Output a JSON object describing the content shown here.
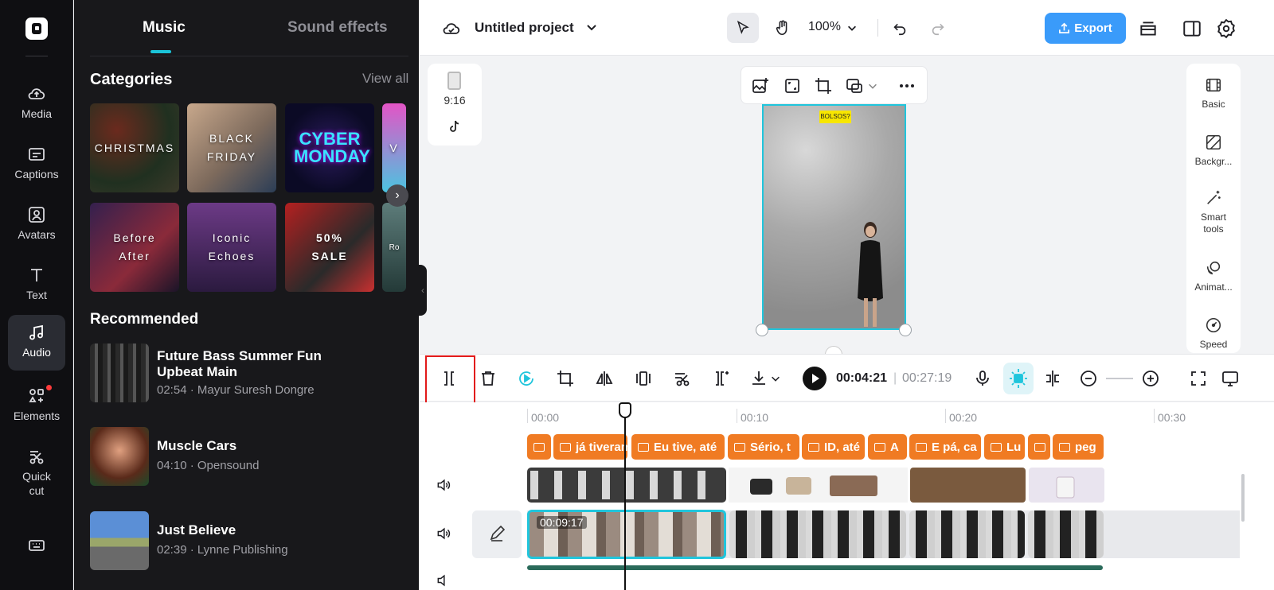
{
  "app": {
    "project_title": "Untitled project",
    "zoom": "100%",
    "export_label": "Export"
  },
  "rail": {
    "items": [
      {
        "label": "Media",
        "icon": "cloud-upload-icon"
      },
      {
        "label": "Captions",
        "icon": "captions-icon"
      },
      {
        "label": "Avatars",
        "icon": "avatar-icon"
      },
      {
        "label": "Text",
        "icon": "text-icon"
      },
      {
        "label": "Audio",
        "icon": "music-note-icon",
        "active": true
      },
      {
        "label": "Elements",
        "icon": "elements-icon",
        "badge": true
      },
      {
        "label": "Quick\ncut",
        "icon": "quick-cut-icon"
      },
      {
        "label": "",
        "icon": "keyboard-icon"
      }
    ]
  },
  "panel": {
    "tabs": [
      "Music",
      "Sound effects"
    ],
    "active_tab": "Music",
    "categories_title": "Categories",
    "view_all": "View all",
    "categories": [
      "CHRISTMAS",
      "BLACK FRIDAY",
      "CYBER MONDAY",
      "V",
      "Before After",
      "Iconic Echoes",
      "50% SALE",
      "Ro"
    ],
    "recommended_title": "Recommended",
    "tracks": [
      {
        "title": "Future Bass Summer Fun Upbeat Main",
        "meta": "02:54 · Mayur Suresh Dongre"
      },
      {
        "title": "Muscle Cars",
        "meta": "04:10 · Opensound"
      },
      {
        "title": "Just Believe",
        "meta": "02:39 · Lynne Publishing"
      }
    ]
  },
  "canvas": {
    "aspect_ratio": "9:16",
    "sticker_text": "BOLSOS?"
  },
  "properties": [
    {
      "label": "Basic",
      "icon": "film-icon"
    },
    {
      "label": "Backgr...",
      "icon": "background-icon"
    },
    {
      "label": "Smart tools",
      "icon": "magic-wand-icon"
    },
    {
      "label": "Animat...",
      "icon": "animation-icon"
    },
    {
      "label": "Speed",
      "icon": "speed-icon"
    }
  ],
  "timeline": {
    "current_time": "00:04:21",
    "separator": "|",
    "total_time": "00:27:19",
    "ticks": [
      "00:00",
      "00:10",
      "00:20",
      "00:30"
    ],
    "captions": [
      "",
      "já tiveram",
      "Eu tive, até",
      "Sério, t",
      "ID, até",
      "A",
      "E pá, ca",
      "Lu",
      "",
      "peg"
    ],
    "selected_clip_duration": "00:09:17"
  },
  "colors": {
    "accent": "#20c5dc",
    "export": "#3a9bfa",
    "caption": "#f07b23",
    "highlight": "#e21a1a"
  }
}
